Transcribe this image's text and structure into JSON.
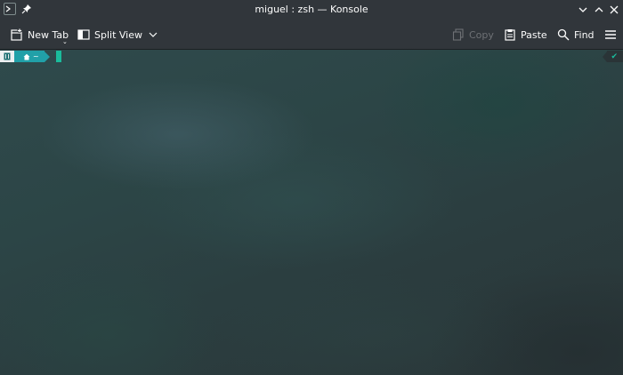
{
  "window": {
    "title": "miguel : zsh — Konsole"
  },
  "toolbar": {
    "new_tab_label": "New Tab",
    "split_view_label": "Split View",
    "copy_label": "Copy",
    "paste_label": "Paste",
    "find_label": "Find"
  },
  "prompt": {
    "dir": "~",
    "status_icon": "✔"
  },
  "icons": {
    "app": "terminal-icon",
    "pin": "pin-icon",
    "minimize": "chevron-down-icon",
    "maximize": "chevron-up-icon",
    "close": "close-icon",
    "new_tab": "new-tab-icon",
    "split_view": "split-view-icon",
    "copy": "copy-icon",
    "paste": "paste-icon",
    "find": "search-icon",
    "menu": "hamburger-menu-icon",
    "home": "home-icon"
  },
  "colors": {
    "titlebar_bg": "#31363b",
    "text": "#fcfcfc",
    "disabled_text": "#6e7175",
    "prompt_dir_bg": "#21a0a8",
    "cursor": "#1abc9c"
  }
}
